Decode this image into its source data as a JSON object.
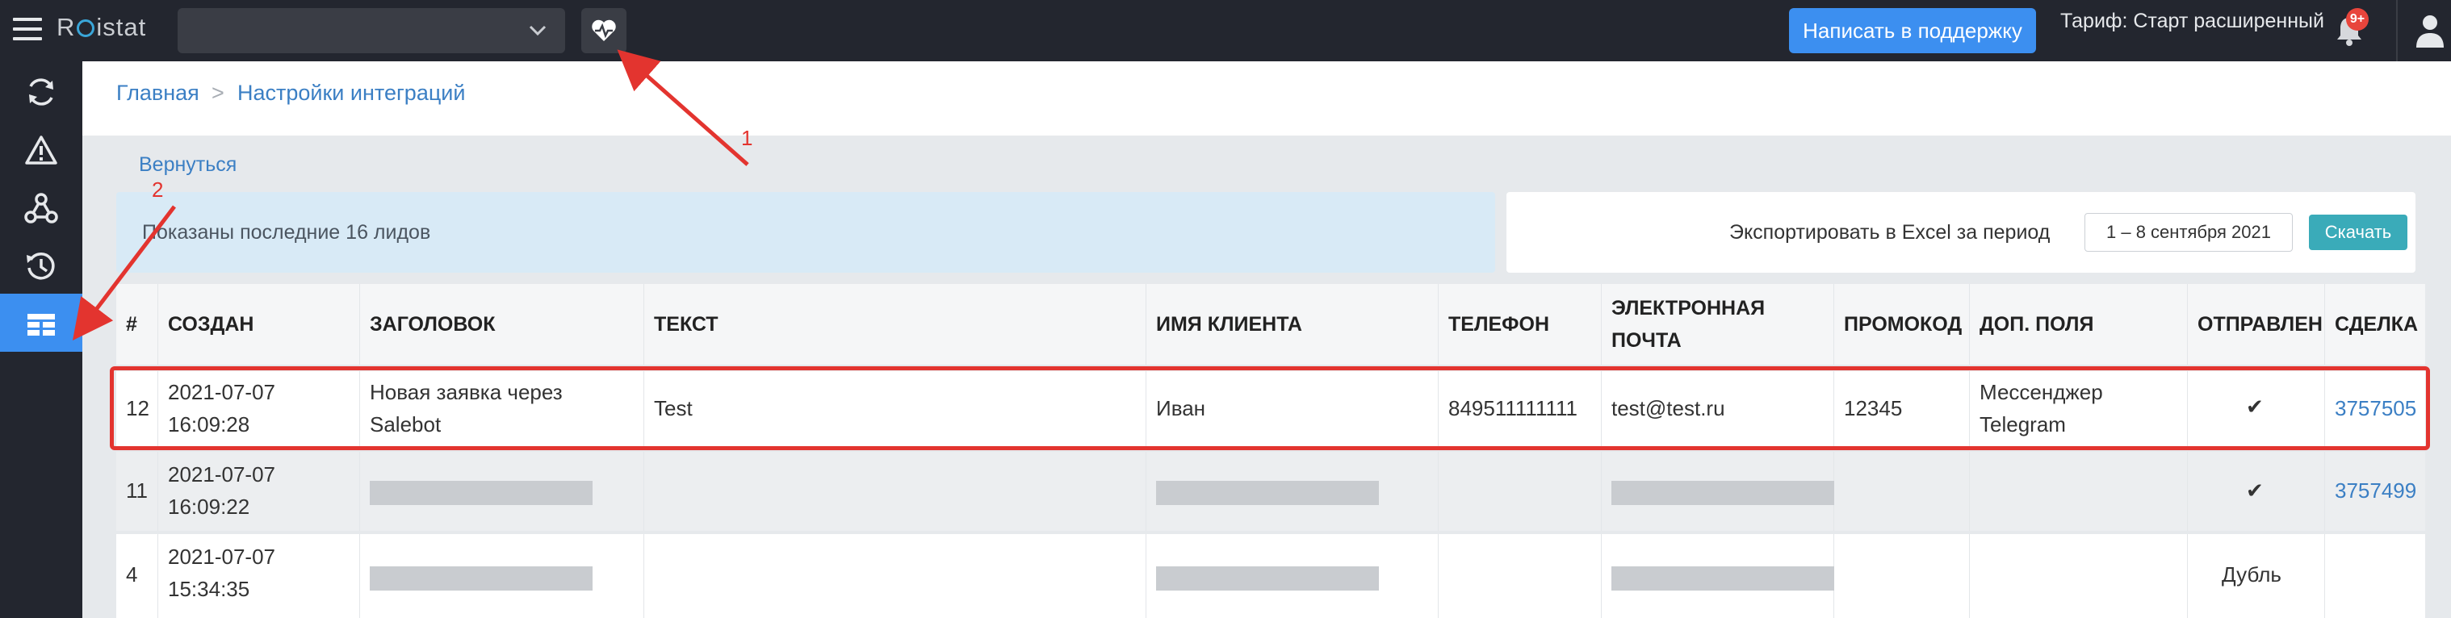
{
  "topbar": {
    "logo_text": "Roistat",
    "project_select_value": "",
    "support_button": "Написать в поддержку",
    "tariff": "Тариф: Старт расширенный",
    "notification_badge": "9+"
  },
  "sidebar": {
    "items": [
      {
        "icon": "refresh-icon"
      },
      {
        "icon": "warning-icon"
      },
      {
        "icon": "integration-icon"
      },
      {
        "icon": "history-icon"
      },
      {
        "icon": "table-icon",
        "active": true
      }
    ]
  },
  "breadcrumb": [
    "Главная",
    "Настройки интеграций"
  ],
  "back_link": "Вернуться",
  "info_text": "Показаны последние 16 лидов",
  "export": {
    "label": "Экспортировать в Excel за период",
    "period": "1 – 8 сентября 2021",
    "button": "Скачать"
  },
  "table": {
    "headers": [
      "#",
      "СОЗДАН",
      "ЗАГОЛОВОК",
      "ТЕКСТ",
      "ИМЯ КЛИЕНТА",
      "ТЕЛЕФОН",
      "ЭЛЕКТРОННАЯ ПОЧТА",
      "ПРОМОКОД",
      "ДОП. ПОЛЯ",
      "ОТПРАВЛЕН",
      "СДЕЛКА"
    ],
    "rows": [
      {
        "num": "12",
        "created_date": "2021-07-07",
        "created_time": "16:09:28",
        "title_line1": "Новая заявка через",
        "title_line2": "Salebot",
        "text": "Test",
        "client": "Иван",
        "phone": "849511111111",
        "email": "test@test.ru",
        "promo": "12345",
        "extra_line1": "Мессенджер",
        "extra_line2": "Telegram",
        "sent": "✔",
        "deal": "3757505"
      },
      {
        "num": "11",
        "created_date": "2021-07-07",
        "created_time": "16:09:22",
        "sent": "✔",
        "deal": "3757499"
      },
      {
        "num": "4",
        "created_date": "2021-07-07",
        "created_time": "15:34:35",
        "sent": "Дубль",
        "deal": ""
      }
    ]
  },
  "annotations": [
    "1",
    "2"
  ],
  "colors": {
    "accent": "#3c8ff0",
    "topbar": "#23262f",
    "highlight": "#e3342f",
    "link": "#3b7fc4"
  }
}
